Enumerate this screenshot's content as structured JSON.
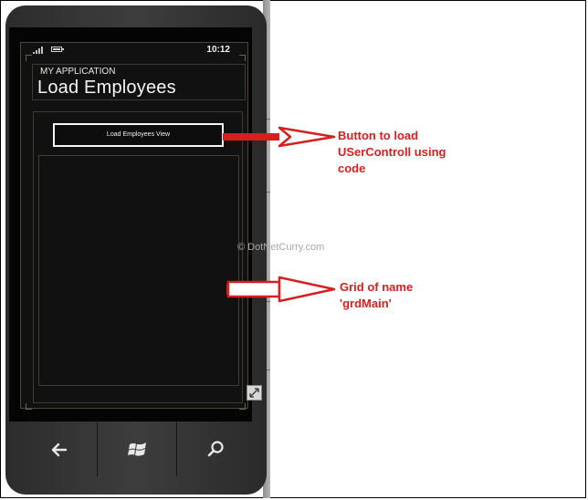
{
  "status_bar": {
    "time": "10:12"
  },
  "app": {
    "app_name": "MY APPLICATION",
    "page_title": "Load Employees",
    "button_label": "Load Employees View"
  },
  "annotations": {
    "button_note_line1": "Button to load",
    "button_note_line2": "USerControll using",
    "button_note_line3": "code",
    "grid_note_line1": "Grid of name",
    "grid_note_line2": "'grdMain'",
    "watermark": "© DotNetCurry.com"
  },
  "icons": {
    "back": "back-arrow-icon",
    "start": "windows-logo-icon",
    "search": "search-icon",
    "expand": "expand-icon",
    "signal": "signal-icon",
    "battery": "battery-icon"
  },
  "colors": {
    "annotation_red": "#d42020",
    "phone_body": "#333333",
    "screen_bg": "#111111",
    "text_white": "#f4f4f4"
  }
}
